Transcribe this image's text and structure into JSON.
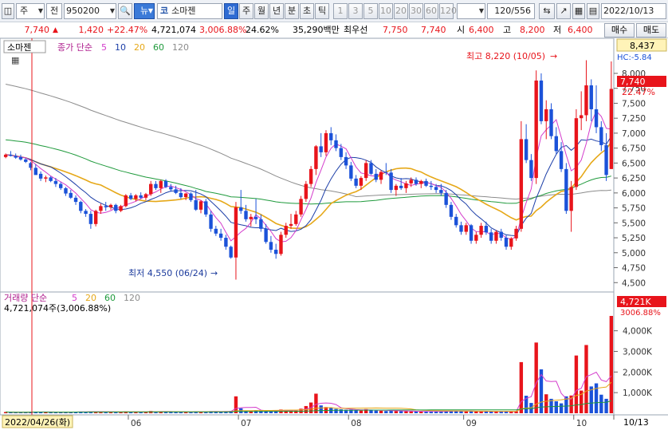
{
  "toolbar": {
    "market": "주",
    "type": "전",
    "code": "950200",
    "news_badge": "뉴",
    "market_badge": "코",
    "stock_name": "소마젠",
    "periods": [
      "일",
      "주",
      "월",
      "년",
      "분",
      "초",
      "틱"
    ],
    "intervals": [
      "1",
      "3",
      "5",
      "10",
      "20",
      "30",
      "60",
      "120"
    ],
    "count": "120",
    "total": "/556",
    "date": "2022/10/13"
  },
  "quote": {
    "price": "7,740",
    "change": "1,420",
    "change_pct": "+22.47%",
    "volume": "4,721,074",
    "volume_pct": "3,006.88%",
    "turnover": "24.62%",
    "amount": "35,290백만",
    "priority_label": "최우선",
    "ask": "7,750",
    "bid": "7,740",
    "open_label": "시",
    "open": "6,400",
    "high_label": "고",
    "high": "8,200",
    "low_label": "저",
    "low": "6,400",
    "buy_label": "매수",
    "sell_label": "매도"
  },
  "price_panel": {
    "stock_tag": "소마젠",
    "legend_prefix": "종가 단순",
    "ma_periods": [
      "5",
      "10",
      "20",
      "60",
      "120"
    ],
    "right_top_value": "8,437",
    "hc_label": "HC:-5.84",
    "current_price_label": "7,740",
    "current_pct_label": "22.47%",
    "max_annotation": "최고 8,220 (10/05)",
    "min_annotation": "최저 4,550 (06/24)"
  },
  "volume_panel": {
    "legend_prefix": "거래량 단순",
    "ma_periods": [
      "5",
      "20",
      "60",
      "120"
    ],
    "volume_text": "4,721,074주(3,006.88%)",
    "right_value": "4,721K",
    "right_pct": "3006.88%"
  },
  "x_axis": {
    "start_date": "2022/04/26(화)",
    "months": [
      "06",
      "07",
      "08",
      "09",
      "10"
    ],
    "end_label": "10/13"
  },
  "colors": {
    "up": "#e8141b",
    "down": "#1b52d9",
    "ma5": "#d43dcc",
    "ma10": "#1d3fa8",
    "ma20": "#e6a818",
    "ma60": "#1f9a3c",
    "ma120": "#8c8c8c"
  },
  "chart_data": {
    "type": "candlestick",
    "y_ticks": [
      "8,000",
      "7,750",
      "7,500",
      "7,250",
      "7,000",
      "6,750",
      "6,500",
      "6,250",
      "6,000",
      "5,750",
      "5,500",
      "5,250",
      "5,000",
      "4,750",
      "4,500"
    ],
    "ylim": [
      4450,
      8480
    ],
    "volume_ticks": [
      "4,000K",
      "3,000K",
      "2,000K",
      "1,000K"
    ],
    "volume_ylim": [
      0,
      4721
    ],
    "ohlc": [
      [
        6600,
        6660,
        6580,
        6640
      ],
      [
        6640,
        6700,
        6610,
        6620
      ],
      [
        6620,
        6660,
        6570,
        6590
      ],
      [
        6600,
        6640,
        6540,
        6560
      ],
      [
        6560,
        6580,
        6500,
        6520
      ],
      [
        6500,
        6520,
        6380,
        6420
      ],
      [
        6420,
        6480,
        6310,
        6300
      ],
      [
        6320,
        6360,
        6200,
        6240
      ],
      [
        6240,
        6290,
        6180,
        6260
      ],
      [
        6260,
        6280,
        6180,
        6200
      ],
      [
        6200,
        6250,
        6100,
        6150
      ],
      [
        6150,
        6180,
        6050,
        6080
      ],
      [
        6080,
        6100,
        5950,
        5990
      ],
      [
        6000,
        6050,
        5900,
        5920
      ],
      [
        5920,
        5960,
        5800,
        5850
      ],
      [
        5850,
        5870,
        5660,
        5700
      ],
      [
        5700,
        5730,
        5600,
        5650
      ],
      [
        5650,
        5700,
        5400,
        5480
      ],
      [
        5480,
        5720,
        5440,
        5700
      ],
      [
        5700,
        5820,
        5650,
        5780
      ],
      [
        5780,
        5850,
        5700,
        5760
      ],
      [
        5760,
        5820,
        5720,
        5800
      ],
      [
        5800,
        5820,
        5660,
        5700
      ],
      [
        5700,
        5800,
        5680,
        5780
      ],
      [
        5780,
        5980,
        5760,
        5960
      ],
      [
        5960,
        6000,
        5880,
        5900
      ],
      [
        5900,
        5980,
        5860,
        5960
      ],
      [
        5960,
        6010,
        5900,
        5920
      ],
      [
        5920,
        6000,
        5880,
        5980
      ],
      [
        5980,
        6200,
        5950,
        6150
      ],
      [
        6150,
        6200,
        6050,
        6080
      ],
      [
        6080,
        6220,
        6000,
        6200
      ],
      [
        6200,
        6230,
        6080,
        6100
      ],
      [
        6100,
        6150,
        6020,
        6060
      ],
      [
        6060,
        6120,
        5980,
        6000
      ],
      [
        6000,
        6080,
        5900,
        5930
      ],
      [
        5930,
        6000,
        5880,
        5990
      ],
      [
        5990,
        6010,
        5850,
        5880
      ],
      [
        5880,
        6050,
        5700,
        5720
      ],
      [
        5720,
        5880,
        5660,
        5860
      ],
      [
        5860,
        5900,
        5600,
        5640
      ],
      [
        5640,
        5700,
        5350,
        5400
      ],
      [
        5400,
        5450,
        5280,
        5320
      ],
      [
        5320,
        5400,
        5200,
        5250
      ],
      [
        5250,
        5300,
        5050,
        5100
      ],
      [
        5100,
        5120,
        4900,
        4920
      ],
      [
        4920,
        5850,
        4550,
        5760
      ],
      [
        5760,
        6050,
        5650,
        5700
      ],
      [
        5700,
        5800,
        5520,
        5560
      ],
      [
        5560,
        5650,
        5440,
        5600
      ],
      [
        5600,
        5900,
        5480,
        5560
      ],
      [
        5560,
        5640,
        5350,
        5400
      ],
      [
        5400,
        5480,
        5150,
        5180
      ],
      [
        5180,
        5280,
        5000,
        5050
      ],
      [
        5050,
        5150,
        4900,
        4980
      ],
      [
        4980,
        5350,
        4950,
        5300
      ],
      [
        5300,
        5500,
        5250,
        5450
      ],
      [
        5450,
        5650,
        5400,
        5480
      ],
      [
        5480,
        5700,
        5450,
        5640
      ],
      [
        5640,
        5950,
        5600,
        5900
      ],
      [
        5900,
        6200,
        5850,
        6150
      ],
      [
        6150,
        6450,
        6100,
        6400
      ],
      [
        6400,
        6800,
        6300,
        6780
      ],
      [
        6780,
        7000,
        6600,
        6680
      ],
      [
        6680,
        7050,
        6620,
        7000
      ],
      [
        7000,
        7100,
        6800,
        6880
      ],
      [
        6880,
        6980,
        6700,
        6750
      ],
      [
        6750,
        6820,
        6550,
        6600
      ],
      [
        6600,
        6680,
        6400,
        6460
      ],
      [
        6460,
        6520,
        6200,
        6240
      ],
      [
        6240,
        6300,
        6080,
        6120
      ],
      [
        6120,
        6280,
        6050,
        6250
      ],
      [
        6250,
        6550,
        6200,
        6500
      ],
      [
        6500,
        6550,
        6300,
        6320
      ],
      [
        6320,
        6400,
        6180,
        6220
      ],
      [
        6220,
        6380,
        6150,
        6350
      ],
      [
        6350,
        6500,
        6300,
        6340
      ],
      [
        6340,
        6400,
        6000,
        6050
      ],
      [
        6050,
        6150,
        5950,
        6120
      ],
      [
        6120,
        6250,
        6050,
        6080
      ],
      [
        6080,
        6200,
        6000,
        6160
      ],
      [
        6160,
        6260,
        6100,
        6220
      ],
      [
        6220,
        6260,
        6120,
        6150
      ],
      [
        6150,
        6220,
        6080,
        6200
      ],
      [
        6200,
        6240,
        6100,
        6120
      ],
      [
        6120,
        6200,
        6050,
        6100
      ],
      [
        6100,
        6150,
        6000,
        6050
      ],
      [
        6050,
        6150,
        5950,
        6000
      ],
      [
        6000,
        6050,
        5750,
        5800
      ],
      [
        5800,
        5850,
        5550,
        5600
      ],
      [
        5600,
        5650,
        5420,
        5460
      ],
      [
        5460,
        5520,
        5300,
        5350
      ],
      [
        5350,
        5500,
        5300,
        5460
      ],
      [
        5460,
        5480,
        5150,
        5200
      ],
      [
        5200,
        5350,
        5150,
        5300
      ],
      [
        5300,
        5500,
        5250,
        5450
      ],
      [
        5450,
        5520,
        5300,
        5340
      ],
      [
        5340,
        5400,
        5150,
        5200
      ],
      [
        5200,
        5380,
        5150,
        5350
      ],
      [
        5350,
        5400,
        5200,
        5250
      ],
      [
        5250,
        5300,
        5050,
        5100
      ],
      [
        5100,
        5260,
        5050,
        5240
      ],
      [
        5240,
        5450,
        5200,
        5400
      ],
      [
        5400,
        7200,
        5350,
        6900
      ],
      [
        6900,
        7150,
        6500,
        6550
      ],
      [
        6550,
        6650,
        6200,
        6250
      ],
      [
        6250,
        8050,
        6150,
        7880
      ],
      [
        7880,
        8000,
        7150,
        7200
      ],
      [
        7200,
        7550,
        6900,
        7400
      ],
      [
        7400,
        7500,
        6900,
        6950
      ],
      [
        6950,
        7100,
        6650,
        6700
      ],
      [
        6700,
        6850,
        6350,
        6400
      ],
      [
        6400,
        6500,
        5650,
        5700
      ],
      [
        5700,
        6200,
        5350,
        6100
      ],
      [
        6100,
        7400,
        6050,
        7250
      ],
      [
        7250,
        7700,
        7050,
        7300
      ],
      [
        7300,
        8220,
        7200,
        7800
      ],
      [
        7800,
        7900,
        7200,
        7400
      ],
      [
        7400,
        7800,
        7000,
        7100
      ],
      [
        7100,
        7200,
        6700,
        6800
      ],
      [
        6800,
        7000,
        6200,
        6300
      ],
      [
        6400,
        8200,
        6400,
        7740
      ]
    ],
    "volume_k": [
      60,
      50,
      40,
      45,
      50,
      70,
      80,
      60,
      55,
      45,
      50,
      55,
      60,
      55,
      70,
      80,
      65,
      90,
      85,
      75,
      60,
      55,
      60,
      60,
      90,
      70,
      65,
      60,
      60,
      110,
      80,
      90,
      70,
      60,
      60,
      70,
      60,
      60,
      90,
      80,
      80,
      100,
      80,
      70,
      90,
      110,
      820,
      240,
      130,
      110,
      150,
      130,
      110,
      100,
      100,
      180,
      160,
      140,
      130,
      220,
      350,
      520,
      950,
      380,
      300,
      260,
      210,
      190,
      170,
      180,
      140,
      130,
      200,
      150,
      130,
      120,
      110,
      140,
      110,
      100,
      95,
      90,
      90,
      85,
      90,
      85,
      90,
      85,
      120,
      130,
      110,
      100,
      90,
      100,
      90,
      85,
      90,
      80,
      90,
      85,
      80,
      90,
      100,
      2480,
      850,
      500,
      3430,
      2130,
      920,
      700,
      580,
      480,
      820,
      860,
      2800,
      1100,
      3310,
      1300,
      1450,
      900,
      700,
      4721
    ]
  }
}
